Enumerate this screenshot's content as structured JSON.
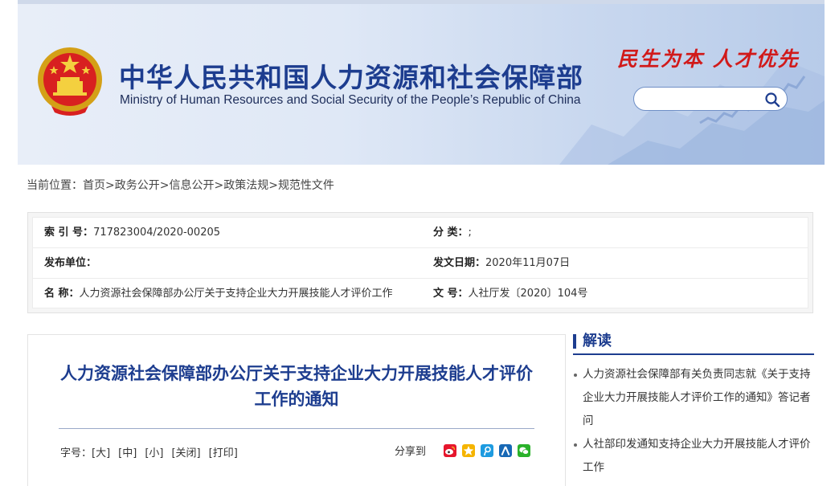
{
  "header": {
    "title_cn": "中华人民共和国人力资源和社会保障部",
    "title_en": "Ministry of Human Resources and Social Security of the People’s Republic of China",
    "slogan": "民生为本 人才优先",
    "emblem_icon": "national-emblem-icon",
    "search": {
      "placeholder": "",
      "value": "",
      "icon": "search-icon"
    },
    "colors": {
      "title": "#1d3d8f",
      "slogan": "#d11a1a"
    }
  },
  "breadcrumb": {
    "prefix": "当前位置：",
    "items": [
      "首页",
      "政务公开",
      "信息公开",
      "政策法规",
      "规范性文件"
    ],
    "separator": ">"
  },
  "info": {
    "index_label": "索 引 号：",
    "index_value": "717823004/2020-00205",
    "category_label": "分 类：",
    "category_value": ";",
    "publisher_label": "发布单位：",
    "publisher_value": "",
    "date_label": "发文日期：",
    "date_value": "2020年11月07日",
    "name_label": "名 称：",
    "name_value": "人力资源社会保障部办公厅关于支持企业大力开展技能人才评价工作",
    "docno_label": "文 号：",
    "docno_value": "人社厅发〔2020〕104号"
  },
  "article": {
    "title": "人力资源社会保障部办公厅关于支持企业大力开展技能人才评价工作的通知",
    "font_size_label": "字号：",
    "font_large": "[大]",
    "font_medium": "[中]",
    "font_small": "[小]",
    "close": "[关闭]",
    "print": "[打印]",
    "share_label": "分享到",
    "share_icons": [
      "weibo-icon",
      "qzone-icon",
      "tencent-weibo-icon",
      "renren-icon",
      "wechat-icon"
    ]
  },
  "sidebar": {
    "heading": "解读",
    "items": [
      "人力资源社会保障部有关负责同志就《关于支持企业大力开展技能人才评价工作的通知》答记者问",
      "人社部印发通知支持企业大力开展技能人才评价工作"
    ]
  }
}
